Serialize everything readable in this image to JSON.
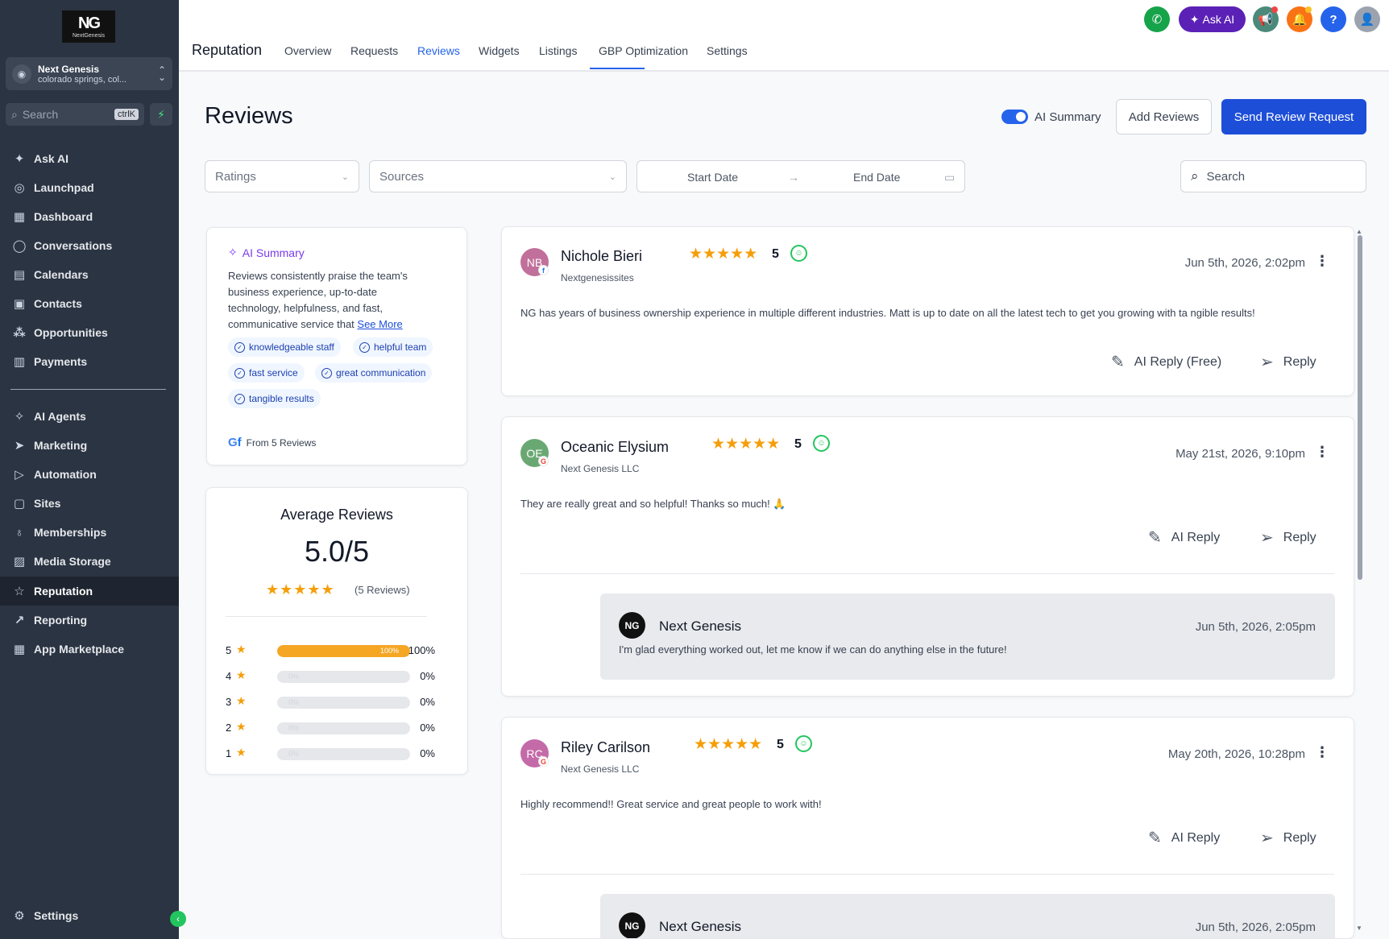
{
  "sidebar": {
    "logo": {
      "mark": "NG",
      "text": "NextGenesis"
    },
    "account": {
      "name": "Next Genesis",
      "location": "colorado springs, col..."
    },
    "search": {
      "placeholder": "Search",
      "shortcut": "ctrlK"
    },
    "items": [
      {
        "label": "Ask AI",
        "icon": "sparkle-icon"
      },
      {
        "label": "Launchpad",
        "icon": "rocket-icon"
      },
      {
        "label": "Dashboard",
        "icon": "grid-icon"
      },
      {
        "label": "Conversations",
        "icon": "chat-icon"
      },
      {
        "label": "Calendars",
        "icon": "calendar-icon"
      },
      {
        "label": "Contacts",
        "icon": "contacts-icon"
      },
      {
        "label": "Opportunities",
        "icon": "funnel-icon"
      },
      {
        "label": "Payments",
        "icon": "receipt-icon"
      },
      {
        "label": "AI Agents",
        "icon": "sparkle-icon"
      },
      {
        "label": "Marketing",
        "icon": "send-icon"
      },
      {
        "label": "Automation",
        "icon": "play-icon"
      },
      {
        "label": "Sites",
        "icon": "sites-icon"
      },
      {
        "label": "Memberships",
        "icon": "award-icon"
      },
      {
        "label": "Media Storage",
        "icon": "image-icon"
      },
      {
        "label": "Reputation",
        "icon": "star-icon"
      },
      {
        "label": "Reporting",
        "icon": "trend-icon"
      },
      {
        "label": "App Marketplace",
        "icon": "apps-icon"
      }
    ],
    "settings_label": "Settings"
  },
  "topbar": {
    "title": "Reputation",
    "tabs": [
      "Overview",
      "Requests",
      "Reviews",
      "Widgets",
      "Listings",
      "GBP Optimization",
      "Settings"
    ],
    "active_tab": "Reviews",
    "ask_ai_label": "Ask AI",
    "help_label": "?"
  },
  "header": {
    "title": "Reviews",
    "ai_summary_toggle_label": "AI Summary",
    "ai_summary_enabled": true,
    "add_reviews_label": "Add Reviews",
    "send_request_label": "Send Review Request"
  },
  "filters": {
    "ratings_placeholder": "Ratings",
    "sources_placeholder": "Sources",
    "start_date_placeholder": "Start Date",
    "end_date_placeholder": "End Date",
    "search_placeholder": "Search"
  },
  "ai_summary": {
    "title": "AI Summary",
    "text": "Reviews consistently praise the team's business experience, up-to-date technology, helpfulness, and fast, communicative service that",
    "see_more": "See More",
    "tags": [
      "knowledgeable staff",
      "helpful team",
      "fast service",
      "great communication",
      "tangible results"
    ],
    "from_label": "From 5 Reviews"
  },
  "average": {
    "title": "Average Reviews",
    "value": "5.0/5",
    "count_label": "(5 Reviews)",
    "rating": 5,
    "distribution": [
      {
        "stars": "5",
        "fraction": 1.0,
        "inner_label": "100%",
        "percent_label": "100%"
      },
      {
        "stars": "4",
        "fraction": 0,
        "inner_label": "0%",
        "percent_label": "0%"
      },
      {
        "stars": "3",
        "fraction": 0,
        "inner_label": "0%",
        "percent_label": "0%"
      },
      {
        "stars": "2",
        "fraction": 0,
        "inner_label": "0%",
        "percent_label": "0%"
      },
      {
        "stars": "1",
        "fraction": 0,
        "inner_label": "0%",
        "percent_label": "0%"
      }
    ]
  },
  "reviews": [
    {
      "initials": "NB",
      "avatar_color": "#c0709a",
      "source_icon": "facebook-icon",
      "name": "Nichole Bieri",
      "source": "Nextgenesissites",
      "rating": 5,
      "score": "5",
      "date": "Jun 5th, 2026, 2:02pm",
      "text": "NG has years of business ownership experience in multiple different industries. Matt is up to date on all the latest tech to get you growing with ta ngible results!",
      "ai_reply_label": "AI Reply (Free)",
      "reply_label": "Reply"
    },
    {
      "initials": "OE",
      "avatar_color": "#6aa873",
      "source_icon": "google-icon",
      "name": "Oceanic Elysium",
      "source": "Next Genesis LLC",
      "rating": 5,
      "score": "5",
      "date": "May 21st, 2026, 9:10pm",
      "text": "They are really great and so helpful! Thanks so much! 🙏",
      "ai_reply_label": "AI Reply",
      "reply_label": "Reply",
      "owner_reply": {
        "logo": "NG",
        "name": "Next Genesis",
        "date": "Jun 5th, 2026, 2:05pm",
        "text": "I'm glad everything worked out, let me know if we can do anything else in the future!"
      }
    },
    {
      "initials": "RC",
      "avatar_color": "#c46aa8",
      "source_icon": "google-icon",
      "name": "Riley Carilson",
      "source": "Next Genesis LLC",
      "rating": 5,
      "score": "5",
      "date": "May 20th, 2026, 10:28pm",
      "text": "Highly recommend!! Great service and great people to work with!",
      "ai_reply_label": "AI Reply",
      "reply_label": "Reply",
      "owner_reply": {
        "logo": "NG",
        "name": "Next Genesis",
        "date": "Jun 5th, 2026, 2:05pm",
        "text": ""
      }
    }
  ],
  "colors": {
    "primary": "#1d4ed8",
    "sidebar": "#2b3442",
    "star": "#f59e0b",
    "ai_purple": "#5b21b6"
  }
}
